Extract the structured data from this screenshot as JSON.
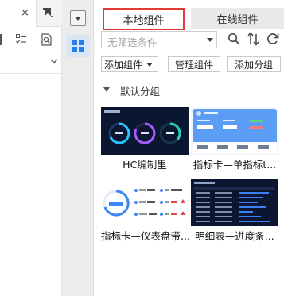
{
  "left_panel": {
    "close_glyph": "×"
  },
  "tabs": {
    "local": "本地组件",
    "online": "在线组件"
  },
  "filter": {
    "placeholder": "无筛选条件"
  },
  "actions": {
    "add_widget": "添加组件",
    "manage_widget": "管理组件",
    "add_group": "添加分组"
  },
  "group": {
    "name": "默认分组"
  },
  "cards": [
    {
      "label": "HC编制里"
    },
    {
      "label": "指标卡—单指标t..."
    },
    {
      "label": "指标卡—仪表盘带..."
    },
    {
      "label": "明细表—进度条..."
    }
  ],
  "colors": {
    "accent": "#2b7de9",
    "highlight_border": "#e53935",
    "dark_thumb_bg": "#0b1730"
  }
}
